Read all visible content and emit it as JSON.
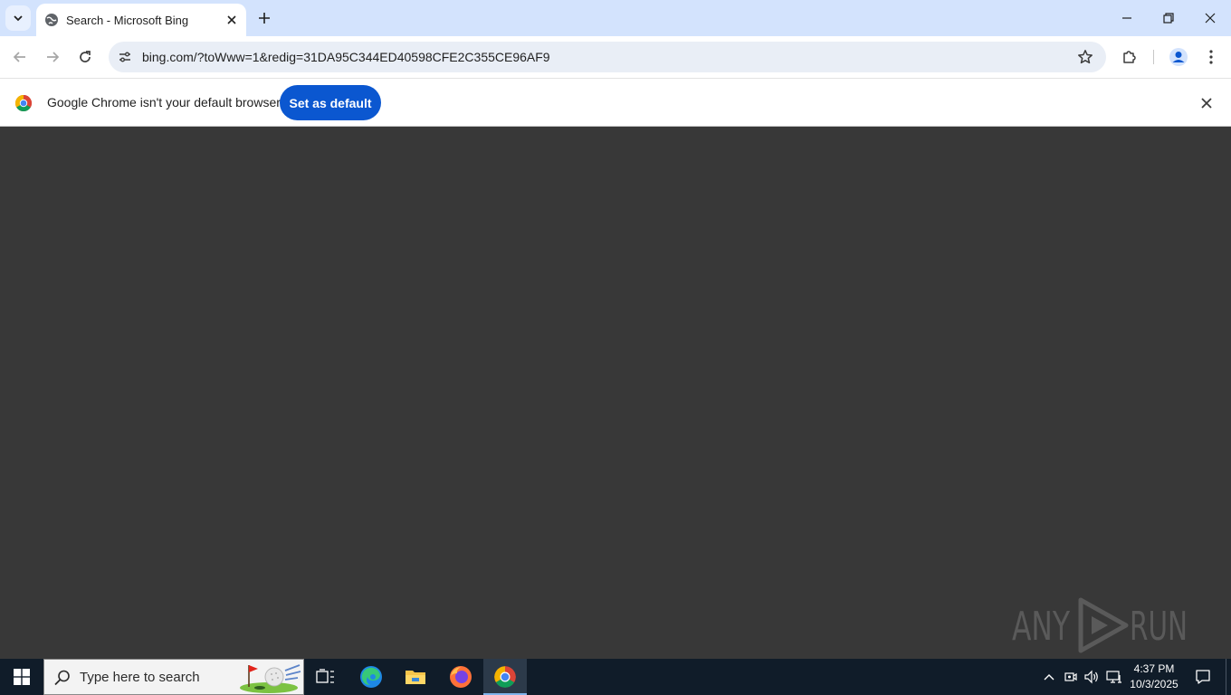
{
  "browser": {
    "tab": {
      "title": "Search - Microsoft Bing"
    },
    "address_bar": {
      "url": "bing.com/?toWww=1&redig=31DA95C344ED40598CFE2C355CE96AF9"
    },
    "infobar": {
      "message": "Google Chrome isn't your default browser",
      "button_label": "Set as default"
    }
  },
  "content": {
    "watermark": "ANY RUN"
  },
  "taskbar": {
    "search_placeholder": "Type here to search",
    "clock_time": "4:37 PM",
    "clock_date": "10/3/2025"
  },
  "colors": {
    "tabstrip_bg": "#d3e3fd",
    "accent_button": "#0b57d0",
    "page_bg": "#383838",
    "taskbar_bg": "#101c29"
  }
}
